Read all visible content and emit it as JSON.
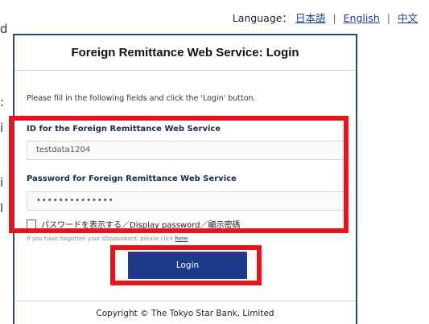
{
  "language_bar": {
    "label": "Language：",
    "links": [
      "日本語",
      "English",
      "中文"
    ],
    "separator": "|"
  },
  "background_fragments": [
    "d",
    ":",
    "i",
    "i",
    "l"
  ],
  "login": {
    "title": "Foreign Remittance Web Service: Login",
    "instructions": "Please fill in the following fields and click the 'Login' button.",
    "id_label": "ID for the Foreign Remittance Web Service",
    "id_value": "testdata1204",
    "password_label": "Password for Foreign Remittance Web Service",
    "password_value": "••••••••••••••",
    "show_password_label": "パスワードを表示する／Display password／顯示密碼",
    "show_password_checked": false,
    "forgot_text": "If you have forgotten your ID/password, please click ",
    "forgot_link": "here",
    "forgot_end": ".",
    "login_button": "Login",
    "copyright": "Copyright © The Tokyo Star Bank, Limited"
  },
  "colors": {
    "highlight": "#e8141c",
    "button": "#1e3a8a",
    "card_border": "#2b4a70",
    "link": "#1a3a9c"
  }
}
